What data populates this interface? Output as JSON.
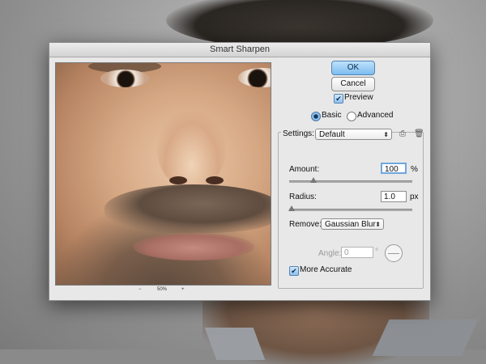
{
  "dialog": {
    "title": "Smart Sharpen",
    "ok_label": "OK",
    "cancel_label": "Cancel",
    "preview_label": "Preview",
    "preview_checked": true,
    "mode_basic": "Basic",
    "mode_advanced": "Advanced",
    "mode_selected": "Basic",
    "settings_label": "Settings:",
    "settings_value": "Default",
    "amount_label": "Amount:",
    "amount_value": "100",
    "amount_unit": "%",
    "amount_fraction": 0.2,
    "radius_label": "Radius:",
    "radius_value": "1.0",
    "radius_unit": "px",
    "radius_fraction": 0.02,
    "remove_label": "Remove:",
    "remove_value": "Gaussian Blur",
    "angle_label": "Angle:",
    "angle_value": "0",
    "angle_unit": "°",
    "more_accurate_label": "More Accurate",
    "more_accurate_checked": true,
    "zoom_minus": "−",
    "zoom_level": "50%",
    "zoom_plus": "+"
  },
  "icons": {
    "check": "✔",
    "dropdown_arrow": "⬍",
    "save_preset": "save-preset-icon",
    "delete_preset": "trash-icon"
  }
}
